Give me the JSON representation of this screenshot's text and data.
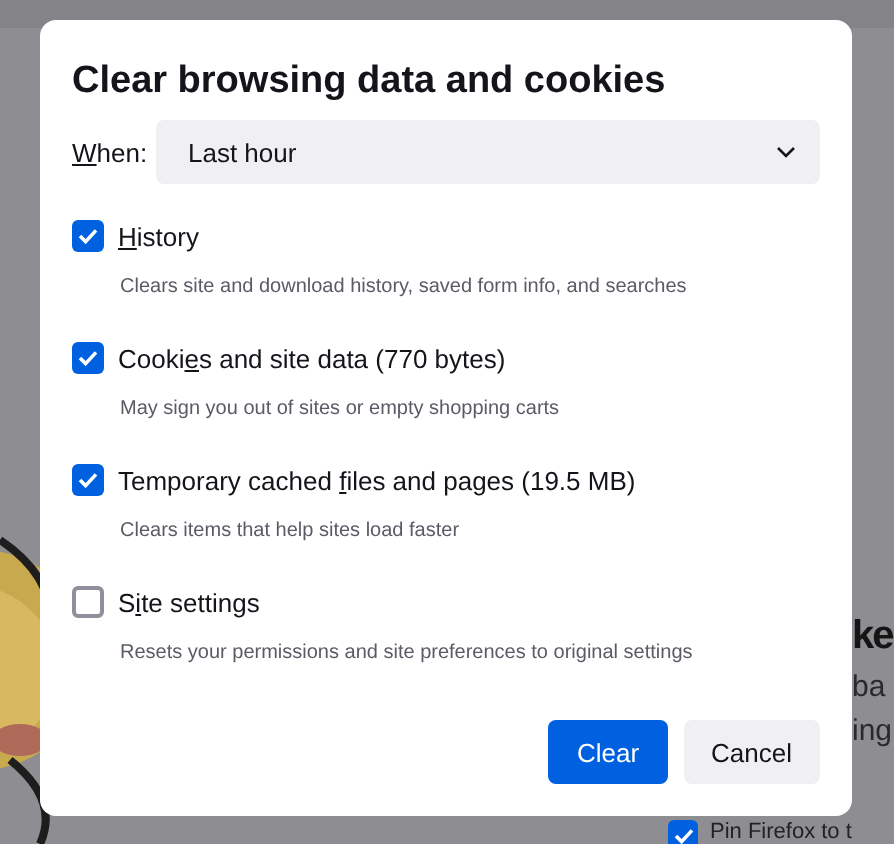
{
  "dialog": {
    "title": "Clear browsing data and cookies",
    "when": {
      "label_accesskey": "W",
      "label_rest": "hen:",
      "value": "Last hour"
    },
    "options": [
      {
        "accesskey": "H",
        "after": "istory",
        "description": "Clears site and download history, saved form info, and searches",
        "checked": true
      },
      {
        "before": "Cooki",
        "accesskey": "e",
        "after": "s and site data (770 bytes)",
        "description": "May sign you out of sites or empty shopping carts",
        "checked": true
      },
      {
        "before": "Temporary cached ",
        "accesskey": "f",
        "after": "iles and pages (19.5 MB)",
        "description": "Clears items that help sites load faster",
        "checked": true
      },
      {
        "before": "S",
        "accesskey": "i",
        "after": "te settings",
        "description": "Resets your permissions and site preferences to original settings",
        "checked": false
      }
    ],
    "buttons": [
      {
        "label": "Clear",
        "kind": "primary"
      },
      {
        "label": "Cancel",
        "kind": "secondary"
      }
    ]
  },
  "background": {
    "items": [
      {
        "kind": "heading",
        "text": "ke"
      },
      {
        "kind": "text",
        "text": "ba"
      },
      {
        "kind": "text",
        "text": "ing"
      },
      {
        "kind": "checkbox",
        "text": "Pin Firefox to t",
        "checked": true
      }
    ]
  }
}
